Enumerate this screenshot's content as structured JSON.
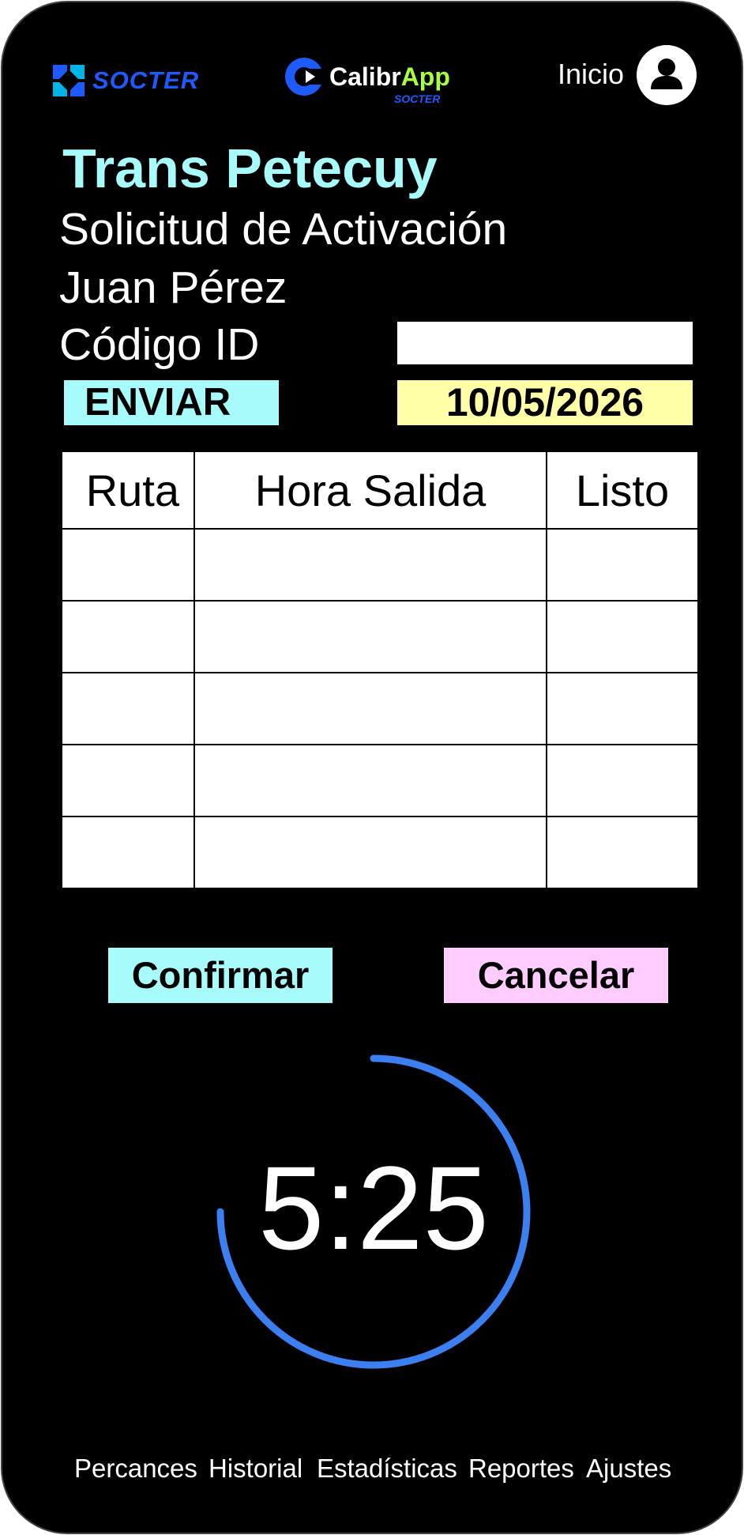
{
  "header": {
    "socter_brand": "SOCTER",
    "calibr_brand_main": "Calibr",
    "calibr_brand_app": "App",
    "calibr_brand_sub": "SOCTER",
    "inicio_label": "Inicio",
    "user_icon": "user-icon"
  },
  "company_name": "Trans Petecuy",
  "request_title": "Solicitud de Activación",
  "user_name": "Juan Pérez",
  "code_label": "Código ID",
  "code_input": {
    "value": "",
    "placeholder": ""
  },
  "send_button": "ENVIAR",
  "date": "10/05/2026",
  "table": {
    "headers": [
      "Ruta",
      "Hora Salida",
      "Listo"
    ],
    "rows": [
      [
        "",
        "",
        ""
      ],
      [
        "",
        "",
        ""
      ],
      [
        "",
        "",
        ""
      ],
      [
        "",
        "",
        ""
      ],
      [
        "",
        "",
        ""
      ]
    ]
  },
  "confirm_button": "Confirmar",
  "cancel_button": "Cancelar",
  "timer": {
    "value": "5:25",
    "progress": 0.75
  },
  "nav": [
    "Percances",
    "Historial",
    "Estadísticas",
    "Reportes",
    "Ajustes"
  ],
  "colors": {
    "accent_cyan": "#a8fbfb",
    "date_yellow": "#ffffa8",
    "cancel_pink": "#ffccff",
    "timer_blue": "#3b7ff0",
    "brand_blue": "#1e5bff",
    "brand_green": "#a8ff3f"
  }
}
